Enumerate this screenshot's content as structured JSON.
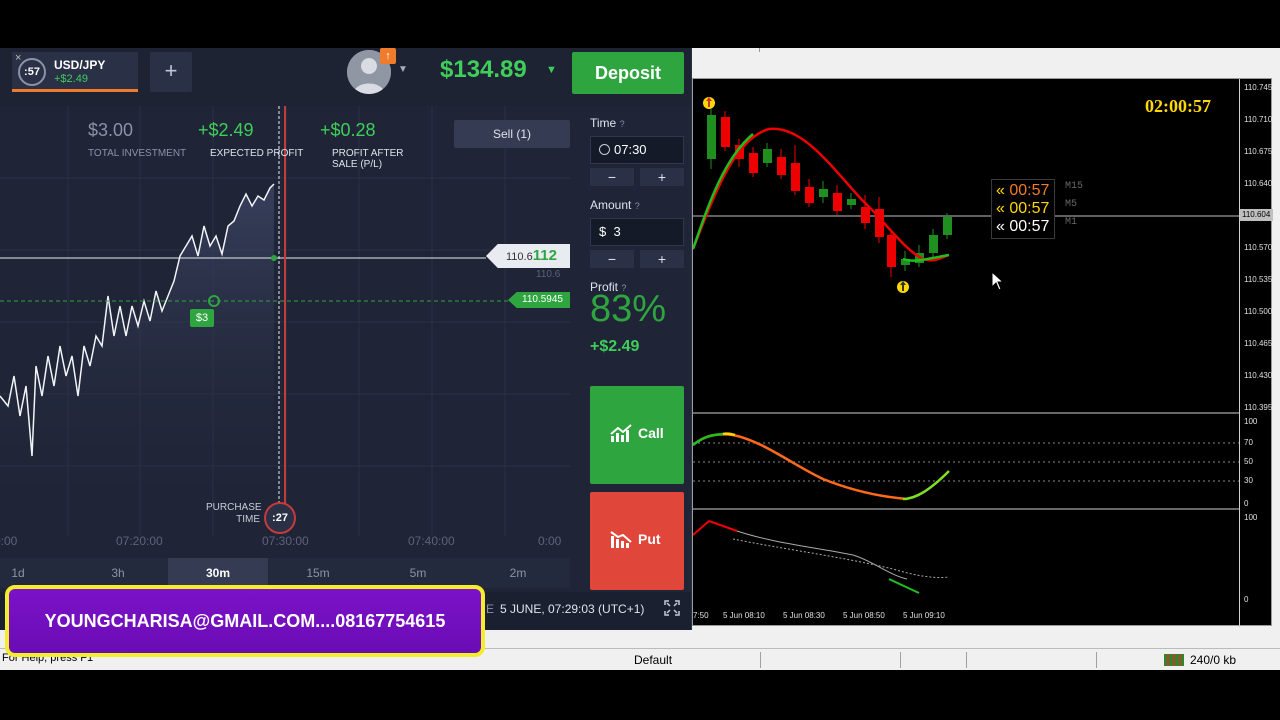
{
  "iq": {
    "asset": {
      "name": "USD/JPY",
      "profit": "+$2.49",
      "timer": ":57",
      "close": "×"
    },
    "add_label": "+",
    "avatar_badge": "↑",
    "balance": "$134.89",
    "deposit_label": "Deposit",
    "stats": {
      "investment_value": "$3.00",
      "investment_label": "TOTAL INVESTMENT",
      "expected_value": "+$2.49",
      "expected_label": "EXPECTED PROFIT",
      "after_sale_value": "+$0.28",
      "after_sale_label": "PROFIT AFTER SALE (P/L)"
    },
    "sell_label": "Sell (1)",
    "price_tag": {
      "prefix": "110.6",
      "suffix": "112",
      "ghost": "110.6",
      "entry": "110.5945"
    },
    "trade_marker": "$3",
    "purchase_label": "PURCHASE TIME",
    "purchase_timer": ":27",
    "time_labels": [
      "0:00",
      "07:20:00",
      "07:30:00",
      "07:40:00",
      "0:00"
    ],
    "periods": [
      "1d",
      "3h",
      "30m",
      "15m",
      "5m",
      "2m"
    ],
    "active_period": "30m",
    "side": {
      "time_label": "Time",
      "time_value": "07:30",
      "amount_label": "Amount",
      "amount_currency": "$",
      "amount_value": "3",
      "minus": "−",
      "plus": "+",
      "profit_label": "Profit",
      "profit_pct": "83%",
      "profit_amt": "+$2.49",
      "call_label": "Call",
      "put_label": "Put"
    },
    "footer": {
      "prefix": "E",
      "datetime": "5 JUNE, 07:29:03 (UTC+1)"
    },
    "colors": {
      "accent_green": "#2fa540",
      "put_red": "#e0473a",
      "bg": "#1f2436",
      "tab_accent": "#f07b2a"
    }
  },
  "mt4": {
    "clock": "02:00:57",
    "timers": [
      {
        "prefix": "«",
        "time": "00:57",
        "tf": "M15",
        "color": "#f07b2a"
      },
      {
        "prefix": "«",
        "time": "00:57",
        "tf": "M5",
        "color": "#ffd800"
      },
      {
        "prefix": "«",
        "time": "00:57",
        "tf": "M1",
        "color": "#ffffff"
      }
    ],
    "price_axis": [
      "110.745",
      "110.710",
      "110.675",
      "110.640",
      "110.604",
      "110.570",
      "110.535",
      "110.500",
      "110.465",
      "110.430",
      "110.395"
    ],
    "current_price": "110.604",
    "osc1_axis": [
      "100",
      "70",
      "50",
      "30",
      "0"
    ],
    "osc2_axis": [
      "100",
      "0"
    ],
    "time_axis": [
      "7:50",
      "5 Jun 08:10",
      "5 Jun 08:30",
      "5 Jun 08:50",
      "5 Jun 09:10"
    ],
    "status": {
      "help": "For Help, press F1",
      "profile": "Default",
      "traffic": "240/0 kb"
    }
  },
  "banner": {
    "text": "YOUNGCHARISA@GMAIL.COM....08167754615"
  }
}
